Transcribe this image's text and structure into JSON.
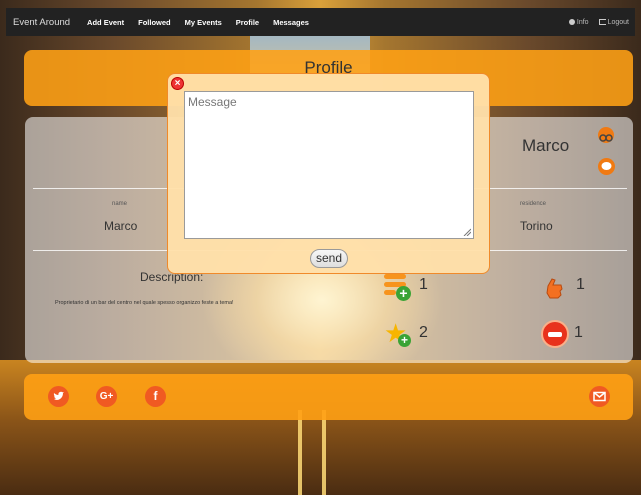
{
  "navbar": {
    "brand": "Event Around",
    "items": [
      "Add Event",
      "Followed",
      "My Events",
      "Profile",
      "Messages"
    ],
    "info_label": "Info",
    "logout_label": "Logout"
  },
  "header": {
    "title": "Profile"
  },
  "profile": {
    "display_name": "Marco",
    "fields": {
      "name_label": "name",
      "name_value": "Marco",
      "residence_label": "residence",
      "residence_value": "Torino"
    },
    "description_title": "Description:",
    "description_text": "Proprietario di un bar del centro nel quale spesso organizzo feste a tema!",
    "stats": {
      "created_events": "1",
      "likes": "1",
      "followed_added": "2",
      "blocked": "1"
    }
  },
  "modal": {
    "placeholder": "Message",
    "send_label": "send"
  },
  "footer": {
    "icons": [
      "twitter-icon",
      "google-plus-icon",
      "facebook-icon",
      "mail-icon"
    ],
    "google_label": "G+",
    "facebook_label": "f"
  },
  "colors": {
    "accent": "#f7941d",
    "footer_icon": "#f05a22",
    "navbar": "#222222"
  }
}
